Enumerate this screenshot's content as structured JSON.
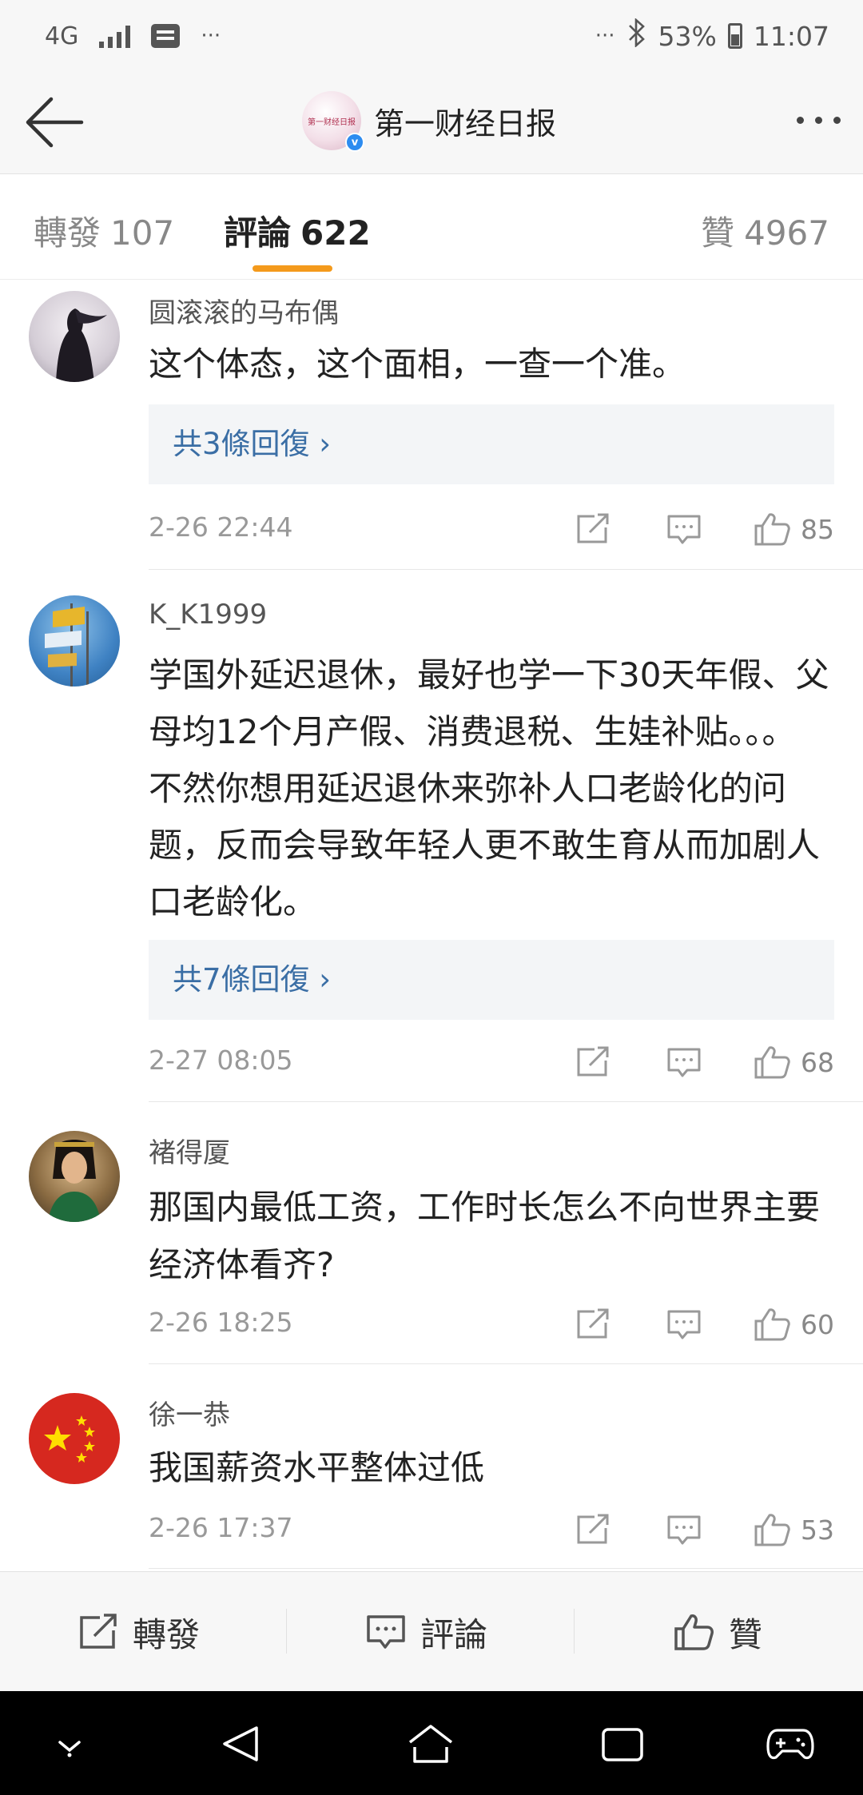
{
  "status_bar": {
    "network": "4G",
    "dots_left": "···",
    "dots_right": "···",
    "battery": "53%",
    "battery_level": 0.53,
    "time": "11:07"
  },
  "header": {
    "account_name": "第一财经日报",
    "avatar_text": "第一财经日报",
    "verified_badge": "v"
  },
  "tabs": [
    {
      "label": "轉發",
      "count": "107"
    },
    {
      "label": "評論",
      "count": "622"
    },
    {
      "label": "贊",
      "count": "4967"
    }
  ],
  "comments": [
    {
      "author": "圆滚滚的马布偶",
      "text": "这个体态，这个面相，一查一个准。",
      "replies": "共3條回復 ›",
      "time": "2-26 22:44",
      "likes": "85"
    },
    {
      "author": "K_K1999",
      "text": "学国外延迟退休，最好也学一下30天年假、父母均12个月产假、消费退税、生娃补贴。。。 不然你想用延迟退休来弥补人口老龄化的问题，反而会导致年轻人更不敢生育从而加剧人口老龄化。",
      "replies": "共7條回復 ›",
      "time": "2-27 08:05",
      "likes": "68"
    },
    {
      "author": "褚得厦",
      "text": "那国内最低工资，工作时长怎么不向世界主要经济体看齐?",
      "time": "2-26 18:25",
      "likes": "60"
    },
    {
      "author": "徐一恭",
      "text": "我国薪资水平整体过低",
      "time": "2-26 17:37",
      "likes": "53"
    }
  ],
  "bottom_bar": {
    "repost": "轉發",
    "comment": "評論",
    "like": "贊"
  },
  "colors": {
    "accent": "#f49a1c",
    "link": "#3a6ea5",
    "verified": "#2d8cf0"
  }
}
